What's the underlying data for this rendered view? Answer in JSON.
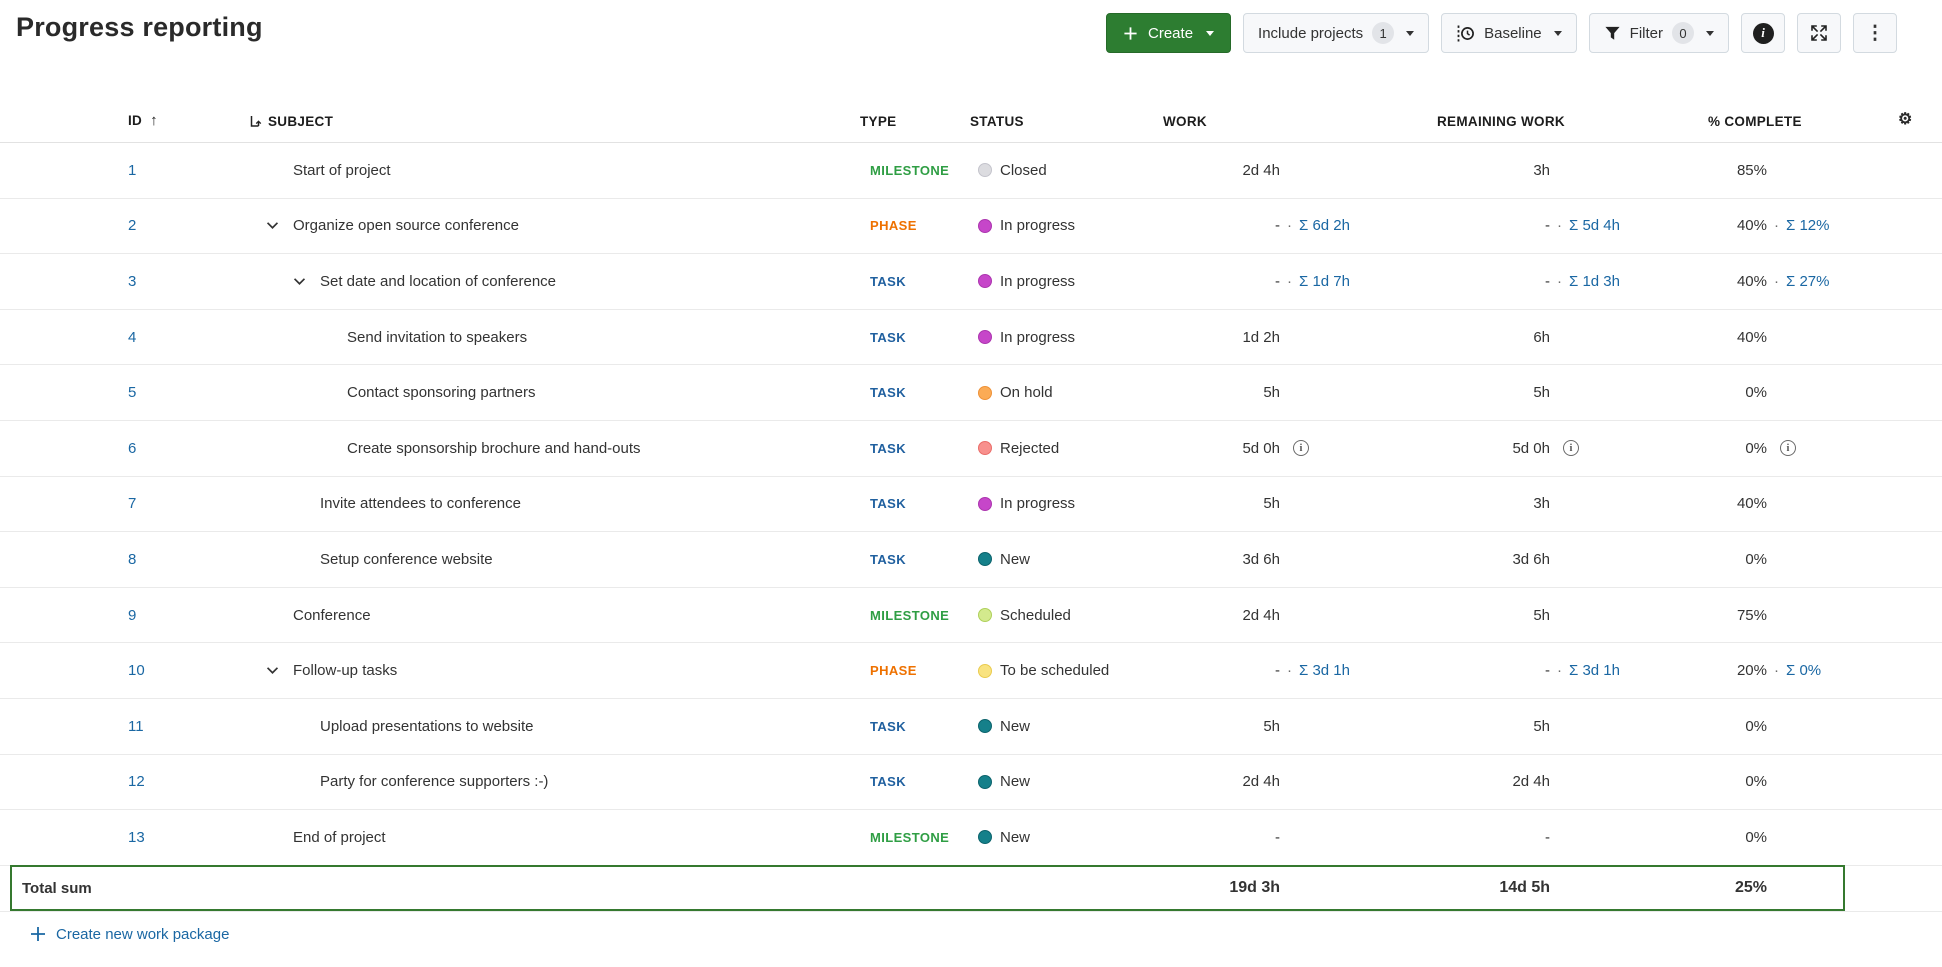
{
  "page": {
    "title": "Progress reporting"
  },
  "toolbar": {
    "create_label": "Create",
    "include_projects_label": "Include projects",
    "include_projects_count": "1",
    "baseline_label": "Baseline",
    "filter_label": "Filter",
    "filter_count": "0"
  },
  "icons": {
    "gear": "⚙",
    "sort_ascending": "↑",
    "kebab": "⋮",
    "info": "i",
    "separator": "·"
  },
  "colors": {
    "link_blue": "#1A67A3",
    "create_button_green": "#2D7D31",
    "total_border_green": "#35792F",
    "type": {
      "MILESTONE": "#2F9E44",
      "PHASE": "#EE7100",
      "TASK": "#20609F"
    },
    "status": {
      "closed": {
        "bg": "#DCDCE0",
        "border": "#C4C4CC"
      },
      "in_progress": {
        "bg": "#C646C9",
        "border": "#AC35AF"
      },
      "on_hold": {
        "bg": "#FBAB55",
        "border": "#EE9137"
      },
      "rejected": {
        "bg": "#F8908D",
        "border": "#EA6D69"
      },
      "new": {
        "bg": "#15808A",
        "border": "#0C636C"
      },
      "scheduled": {
        "bg": "#D3EA8D",
        "border": "#AFD05B"
      },
      "to_be_scheduled": {
        "bg": "#F9E380",
        "border": "#EACB4E"
      }
    }
  },
  "table": {
    "columns": [
      {
        "key": "id",
        "label": "ID"
      },
      {
        "key": "subject",
        "label": "SUBJECT"
      },
      {
        "key": "type",
        "label": "TYPE"
      },
      {
        "key": "status",
        "label": "STATUS"
      },
      {
        "key": "work",
        "label": "WORK"
      },
      {
        "key": "remaining_work",
        "label": "REMAINING WORK"
      },
      {
        "key": "percent_complete",
        "label": "% COMPLETE"
      }
    ],
    "rows": [
      {
        "id": "1",
        "subject": "Start of project",
        "level": 0,
        "expandable": false,
        "type": "MILESTONE",
        "status": "Closed",
        "status_key": "closed",
        "work": {
          "value": "2d 4h"
        },
        "remaining": {
          "value": "3h"
        },
        "percent": {
          "value": "85%"
        }
      },
      {
        "id": "2",
        "subject": "Organize open source conference",
        "level": 0,
        "expandable": true,
        "type": "PHASE",
        "status": "In progress",
        "status_key": "in_progress",
        "work": {
          "value": "-",
          "sum": "Σ 6d 2h"
        },
        "remaining": {
          "value": "-",
          "sum": "Σ 5d 4h"
        },
        "percent": {
          "value": "40%",
          "sum": "Σ 12%"
        }
      },
      {
        "id": "3",
        "subject": "Set date and location of conference",
        "level": 1,
        "expandable": true,
        "type": "TASK",
        "status": "In progress",
        "status_key": "in_progress",
        "work": {
          "value": "-",
          "sum": "Σ 1d 7h"
        },
        "remaining": {
          "value": "-",
          "sum": "Σ 1d 3h"
        },
        "percent": {
          "value": "40%",
          "sum": "Σ 27%"
        }
      },
      {
        "id": "4",
        "subject": "Send invitation to speakers",
        "level": 2,
        "expandable": false,
        "type": "TASK",
        "status": "In progress",
        "status_key": "in_progress",
        "work": {
          "value": "1d 2h"
        },
        "remaining": {
          "value": "6h"
        },
        "percent": {
          "value": "40%"
        }
      },
      {
        "id": "5",
        "subject": "Contact sponsoring partners",
        "level": 2,
        "expandable": false,
        "type": "TASK",
        "status": "On hold",
        "status_key": "on_hold",
        "work": {
          "value": "5h"
        },
        "remaining": {
          "value": "5h"
        },
        "percent": {
          "value": "0%"
        }
      },
      {
        "id": "6",
        "subject": "Create sponsorship brochure and hand-outs",
        "level": 2,
        "expandable": false,
        "type": "TASK",
        "status": "Rejected",
        "status_key": "rejected",
        "work": {
          "value": "5d 0h",
          "info": true
        },
        "remaining": {
          "value": "5d 0h",
          "info": true
        },
        "percent": {
          "value": "0%",
          "info": true
        }
      },
      {
        "id": "7",
        "subject": "Invite attendees to conference",
        "level": 1,
        "expandable": false,
        "type": "TASK",
        "status": "In progress",
        "status_key": "in_progress",
        "work": {
          "value": "5h"
        },
        "remaining": {
          "value": "3h"
        },
        "percent": {
          "value": "40%"
        }
      },
      {
        "id": "8",
        "subject": "Setup conference website",
        "level": 1,
        "expandable": false,
        "type": "TASK",
        "status": "New",
        "status_key": "new",
        "work": {
          "value": "3d 6h"
        },
        "remaining": {
          "value": "3d 6h"
        },
        "percent": {
          "value": "0%"
        }
      },
      {
        "id": "9",
        "subject": "Conference",
        "level": 0,
        "expandable": false,
        "type": "MILESTONE",
        "status": "Scheduled",
        "status_key": "scheduled",
        "work": {
          "value": "2d 4h"
        },
        "remaining": {
          "value": "5h"
        },
        "percent": {
          "value": "75%"
        }
      },
      {
        "id": "10",
        "subject": "Follow-up tasks",
        "level": 0,
        "expandable": true,
        "type": "PHASE",
        "status": "To be scheduled",
        "status_key": "to_be_scheduled",
        "work": {
          "value": "-",
          "sum": "Σ 3d 1h"
        },
        "remaining": {
          "value": "-",
          "sum": "Σ 3d 1h"
        },
        "percent": {
          "value": "20%",
          "sum": "Σ 0%"
        }
      },
      {
        "id": "11",
        "subject": "Upload presentations to website",
        "level": 1,
        "expandable": false,
        "type": "TASK",
        "status": "New",
        "status_key": "new",
        "work": {
          "value": "5h"
        },
        "remaining": {
          "value": "5h"
        },
        "percent": {
          "value": "0%"
        }
      },
      {
        "id": "12",
        "subject": "Party for conference supporters :-)",
        "level": 1,
        "expandable": false,
        "type": "TASK",
        "status": "New",
        "status_key": "new",
        "work": {
          "value": "2d 4h"
        },
        "remaining": {
          "value": "2d 4h"
        },
        "percent": {
          "value": "0%"
        }
      },
      {
        "id": "13",
        "subject": "End of project",
        "level": 0,
        "expandable": false,
        "type": "MILESTONE",
        "status": "New",
        "status_key": "new",
        "work": {
          "value": "-"
        },
        "remaining": {
          "value": "-"
        },
        "percent": {
          "value": "0%"
        }
      }
    ],
    "total": {
      "label": "Total sum",
      "work": "19d 3h",
      "remaining_work": "14d 5h",
      "percent_complete": "25%"
    },
    "footer_link_label": "Create new work package"
  }
}
